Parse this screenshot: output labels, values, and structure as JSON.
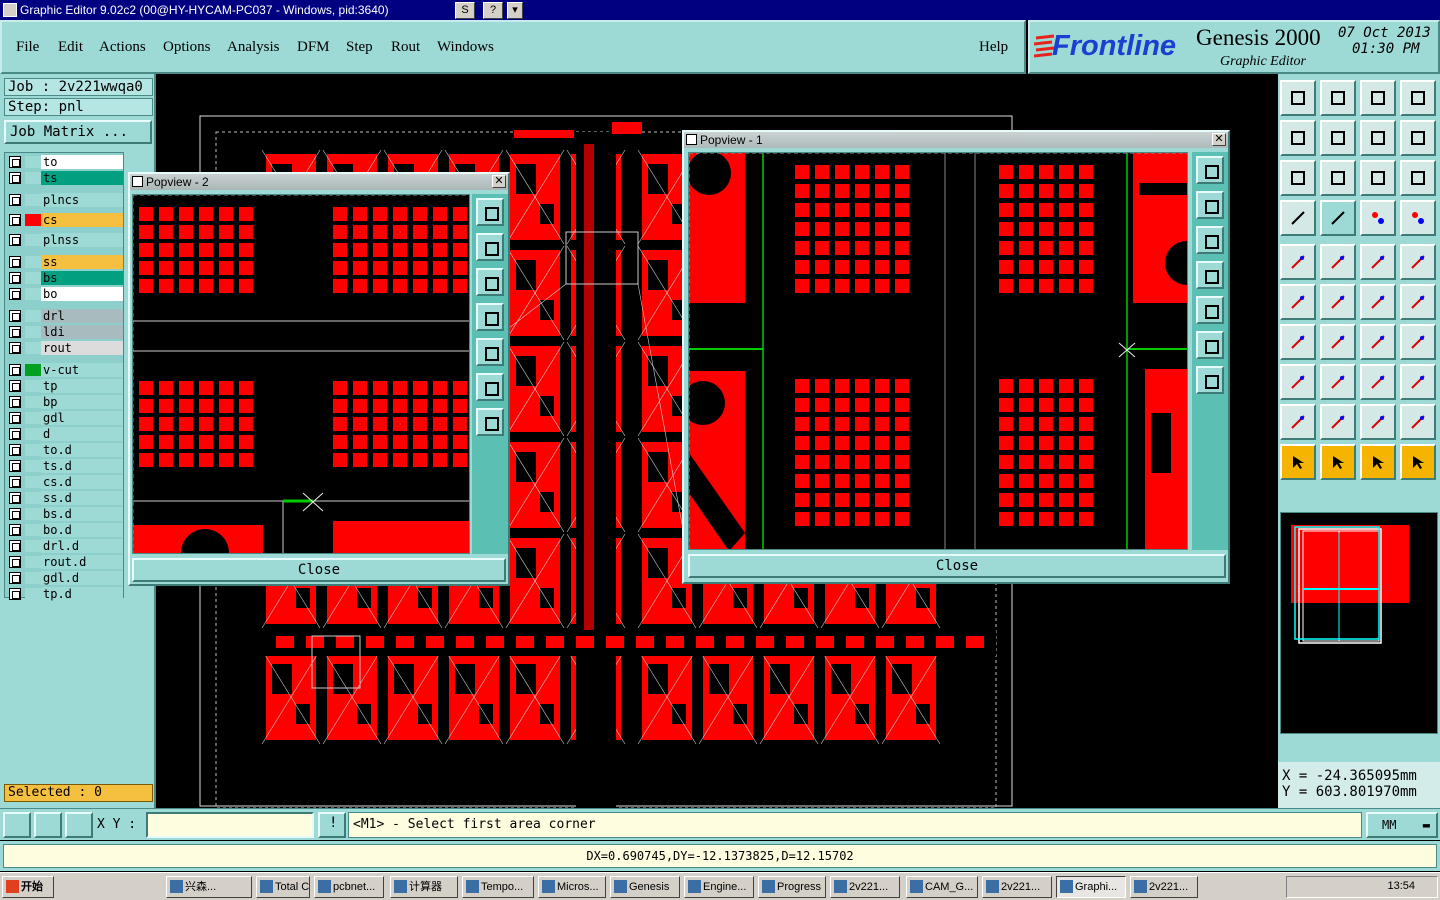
{
  "window": {
    "title": "Graphic Editor 9.02c2 (00@HY-HYCAM-PC037 - Windows, pid:3640)",
    "mini_buttons": [
      "S",
      "?",
      "▾"
    ]
  },
  "menu": {
    "items": [
      "File",
      "Edit",
      "Actions",
      "Options",
      "Analysis",
      "DFM",
      "Step",
      "Rout",
      "Windows"
    ],
    "help": "Help"
  },
  "brand": {
    "logo": "Frontline",
    "product": "Genesis 2000",
    "subtitle": "Graphic Editor",
    "date": "07 Oct 2013",
    "time": "01:30 PM"
  },
  "left_panel": {
    "job": "Job : 2v221wwqa0",
    "step": "Step: pnl",
    "job_matrix": "Job Matrix ...",
    "selected": "Selected : 0",
    "layers": [
      {
        "name": "to",
        "color": "#ffffff",
        "swatch": "#9dd9d5"
      },
      {
        "name": "ts",
        "color": "#00a080",
        "swatch": "#9dd9d5"
      },
      {
        "name": "plncs",
        "color": "#9dd9d5",
        "swatch": "#9dd9d5"
      },
      {
        "name": "cs",
        "color": "#f5c040",
        "swatch": "#ff0000"
      },
      {
        "name": "plnss",
        "color": "#9dd9d5",
        "swatch": "#9dd9d5"
      },
      {
        "name": "ss",
        "color": "#f5c040",
        "swatch": "#9dd9d5"
      },
      {
        "name": "bs",
        "color": "#00a080",
        "swatch": "#9dd9d5"
      },
      {
        "name": "bo",
        "color": "#ffffff",
        "swatch": "#9dd9d5"
      },
      {
        "name": "drl",
        "color": "#a8bcc0",
        "swatch": "#9dd9d5"
      },
      {
        "name": "ldi",
        "color": "#a8bcc0",
        "swatch": "#9dd9d5"
      },
      {
        "name": "rout",
        "color": "#dcdcdc",
        "swatch": "#9dd9d5"
      },
      {
        "name": "v-cut",
        "color": "#9dd9d5",
        "swatch": "#00a020"
      },
      {
        "name": "tp",
        "color": "#9dd9d5",
        "swatch": "#9dd9d5"
      },
      {
        "name": "bp",
        "color": "#9dd9d5",
        "swatch": "#9dd9d5"
      },
      {
        "name": "gdl",
        "color": "#9dd9d5",
        "swatch": "#9dd9d5"
      },
      {
        "name": "d",
        "color": "#9dd9d5",
        "swatch": "#9dd9d5"
      },
      {
        "name": "to.d",
        "color": "#9dd9d5",
        "swatch": "#9dd9d5"
      },
      {
        "name": "ts.d",
        "color": "#9dd9d5",
        "swatch": "#9dd9d5"
      },
      {
        "name": "cs.d",
        "color": "#9dd9d5",
        "swatch": "#9dd9d5"
      },
      {
        "name": "ss.d",
        "color": "#9dd9d5",
        "swatch": "#9dd9d5"
      },
      {
        "name": "bs.d",
        "color": "#9dd9d5",
        "swatch": "#9dd9d5"
      },
      {
        "name": "bo.d",
        "color": "#9dd9d5",
        "swatch": "#9dd9d5"
      },
      {
        "name": "drl.d",
        "color": "#9dd9d5",
        "swatch": "#9dd9d5"
      },
      {
        "name": "rout.d",
        "color": "#9dd9d5",
        "swatch": "#9dd9d5"
      },
      {
        "name": "gdl.d",
        "color": "#9dd9d5",
        "swatch": "#9dd9d5"
      },
      {
        "name": "tp.d",
        "color": "#9dd9d5",
        "swatch": "#9dd9d5"
      }
    ]
  },
  "popview2": {
    "title": "Popview - 2",
    "close": "Close"
  },
  "popview1": {
    "title": "Popview - 1",
    "close": "Close"
  },
  "coords": {
    "x": "X = -24.365095mm",
    "y": "Y = 603.801970mm"
  },
  "bottom": {
    "xy_label": "X Y :",
    "xy_value": "",
    "prompt": "<M1> - Select first area corner",
    "unit": "MM",
    "status": "DX=0.690745,DY=-12.1373825,D=12.15702"
  },
  "taskbar": {
    "start": "开始",
    "tasks": [
      "兴森...",
      "Total C...",
      "pcbnet...",
      "计算器",
      "Tempo...",
      "Micros...",
      "Genesis",
      "Engine...",
      "Progress",
      "2v221...",
      "CAM_G...",
      "2v221...",
      "Graphi...",
      "2v221..."
    ],
    "clock": "13:54"
  },
  "colors": {
    "panel": "#9dd9d5",
    "copper": "#ff0000",
    "titlebar": "#000080",
    "highlight": "#f5b400"
  }
}
